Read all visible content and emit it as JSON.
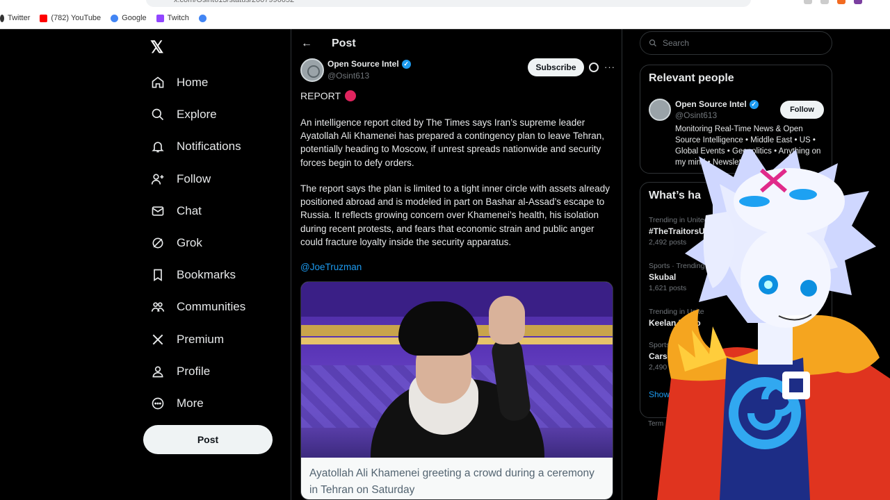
{
  "bookmarks": [
    {
      "label": "Twitter",
      "icon": "bird-icon",
      "color": "#333333"
    },
    {
      "label": "(782) YouTube",
      "icon": "youtube-icon",
      "color": "#ff0000"
    },
    {
      "label": "Google",
      "icon": "google-icon",
      "color": "#4285f4"
    },
    {
      "label": "Twitch",
      "icon": "twitch-icon",
      "color": "#9146ff"
    },
    {
      "label": "",
      "icon": "google-icon",
      "color": "#4285f4"
    }
  ],
  "nav": {
    "logo": "𝕏",
    "items": [
      {
        "label": "Home",
        "icon": "home-icon"
      },
      {
        "label": "Explore",
        "icon": "search-icon"
      },
      {
        "label": "Notifications",
        "icon": "bell-icon"
      },
      {
        "label": "Follow",
        "icon": "add-user-icon"
      },
      {
        "label": "Chat",
        "icon": "mail-icon"
      },
      {
        "label": "Grok",
        "icon": "grok-icon"
      },
      {
        "label": "Bookmarks",
        "icon": "bookmark-icon"
      },
      {
        "label": "Communities",
        "icon": "communities-icon"
      },
      {
        "label": "Premium",
        "icon": "x-icon"
      },
      {
        "label": "Profile",
        "icon": "person-icon"
      },
      {
        "label": "More",
        "icon": "more-circle-icon"
      }
    ],
    "post_label": "Post"
  },
  "post": {
    "header_title": "Post",
    "author_name": "Open Source Intel",
    "author_handle": "@Osint613",
    "subscribe_label": "Subscribe",
    "report_label": "REPORT",
    "paragraph1": "An intelligence report cited by The Times says Iran’s supreme leader Ayatollah Ali Khamenei has prepared a contingency plan to leave Tehran, potentially heading to Moscow, if unrest spreads nationwide and security forces begin to defy orders.",
    "paragraph2": "The report says the plan is limited to a tight inner circle with assets already positioned abroad and is modeled in part on Bashar al-Assad’s escape to Russia. It reflects growing concern over Khamenei’s health, his isolation during recent protests, and fears that economic strain and public anger could fracture loyalty inside the security apparatus.",
    "mention": "@JoeTruzman",
    "media_caption": "Ayatollah Ali Khamenei greeting a crowd during a ceremony in Tehran on Saturday"
  },
  "sidebar": {
    "search_placeholder": "Search",
    "relevant_title": "Relevant people",
    "person_name": "Open Source Intel",
    "person_handle": "@Osint613",
    "follow_label": "Follow",
    "person_bio": "Monitoring Real-Time News & Open Source Intelligence • Middle East • US • Global Events • Geopolitics • Anything on my mind • Newslett",
    "happening_title": "What’s ha",
    "trends": [
      {
        "meta": "Trending in United",
        "name": "#TheTraitorsUS",
        "count": "2,492 posts"
      },
      {
        "meta": "Sports · Trending",
        "name": "Skubal",
        "count": "1,621 posts"
      },
      {
        "meta": "Trending in Unite",
        "name": "Keelan Mario",
        "count": ""
      },
      {
        "meta": "Sports · T",
        "name": "Carson B",
        "count": "2,490 p"
      }
    ],
    "show_more": "Show m",
    "terms": "Term"
  },
  "colors": {
    "accent": "#1d9bf0",
    "background": "#000000",
    "border": "#2f3336",
    "muted": "#71767b"
  }
}
